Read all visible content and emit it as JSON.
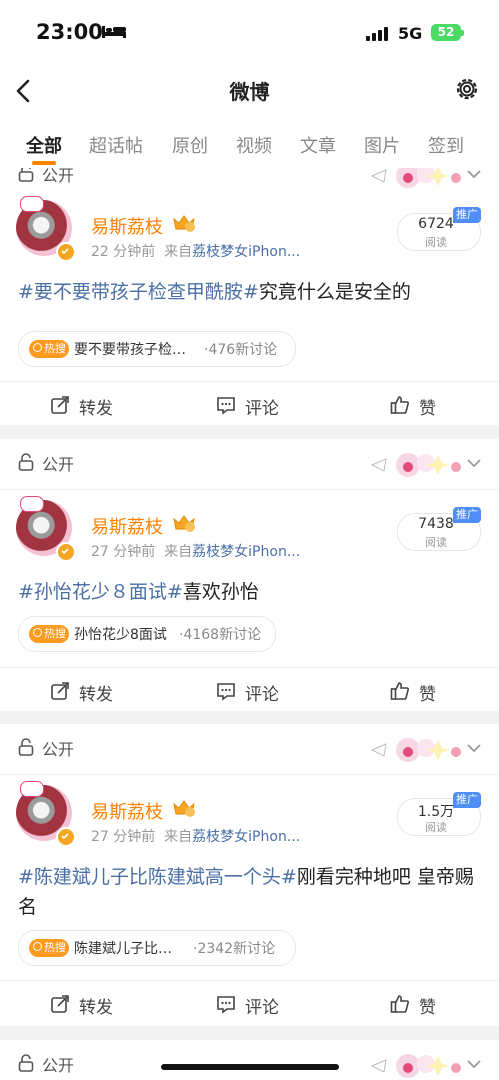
{
  "status": {
    "time": "23:00",
    "network": "5G",
    "battery": "52"
  },
  "nav": {
    "title": "微博"
  },
  "tabs": [
    {
      "label": "全部",
      "active": true
    },
    {
      "label": "超话帖"
    },
    {
      "label": "原创"
    },
    {
      "label": "视频"
    },
    {
      "label": "文章"
    },
    {
      "label": "图片"
    },
    {
      "label": "签到"
    }
  ],
  "privacy_label": "公开",
  "posts": [
    {
      "user": "易斯荔枝",
      "time": "22 分钟前",
      "source_prefix": "来自",
      "source": "荔枝梦女iPhon...",
      "reads": "6724",
      "reads_label": "阅读",
      "promo": "推广",
      "hashtag": "#要不要带孩子检查甲酰胺#",
      "text": "究竟什么是安全的",
      "hot_badge": "热搜",
      "hot_topic": "要不要带孩子检…",
      "hot_count": "·476新讨论",
      "actions": {
        "repost": "转发",
        "comment": "评论",
        "like": "赞"
      }
    },
    {
      "user": "易斯荔枝",
      "time": "27 分钟前",
      "source_prefix": "来自",
      "source": "荔枝梦女iPhon...",
      "reads": "7438",
      "reads_label": "阅读",
      "promo": "推广",
      "hashtag": "#孙怡花少８面试#",
      "text": "喜欢孙怡",
      "hot_badge": "热搜",
      "hot_topic": "孙怡花少8面试",
      "hot_count": "·4168新讨论",
      "actions": {
        "repost": "转发",
        "comment": "评论",
        "like": "赞"
      }
    },
    {
      "user": "易斯荔枝",
      "time": "27 分钟前",
      "source_prefix": "来自",
      "source": "荔枝梦女iPhon...",
      "reads": "1.5万",
      "reads_label": "阅读",
      "promo": "推广",
      "hashtag": "#陈建斌儿子比陈建斌高一个头#",
      "text": "刚看完种地吧 皇帝赐名",
      "hot_badge": "热搜",
      "hot_topic": "陈建斌儿子比…",
      "hot_count": "·2342新讨论",
      "actions": {
        "repost": "转发",
        "comment": "评论",
        "like": "赞"
      }
    }
  ]
}
